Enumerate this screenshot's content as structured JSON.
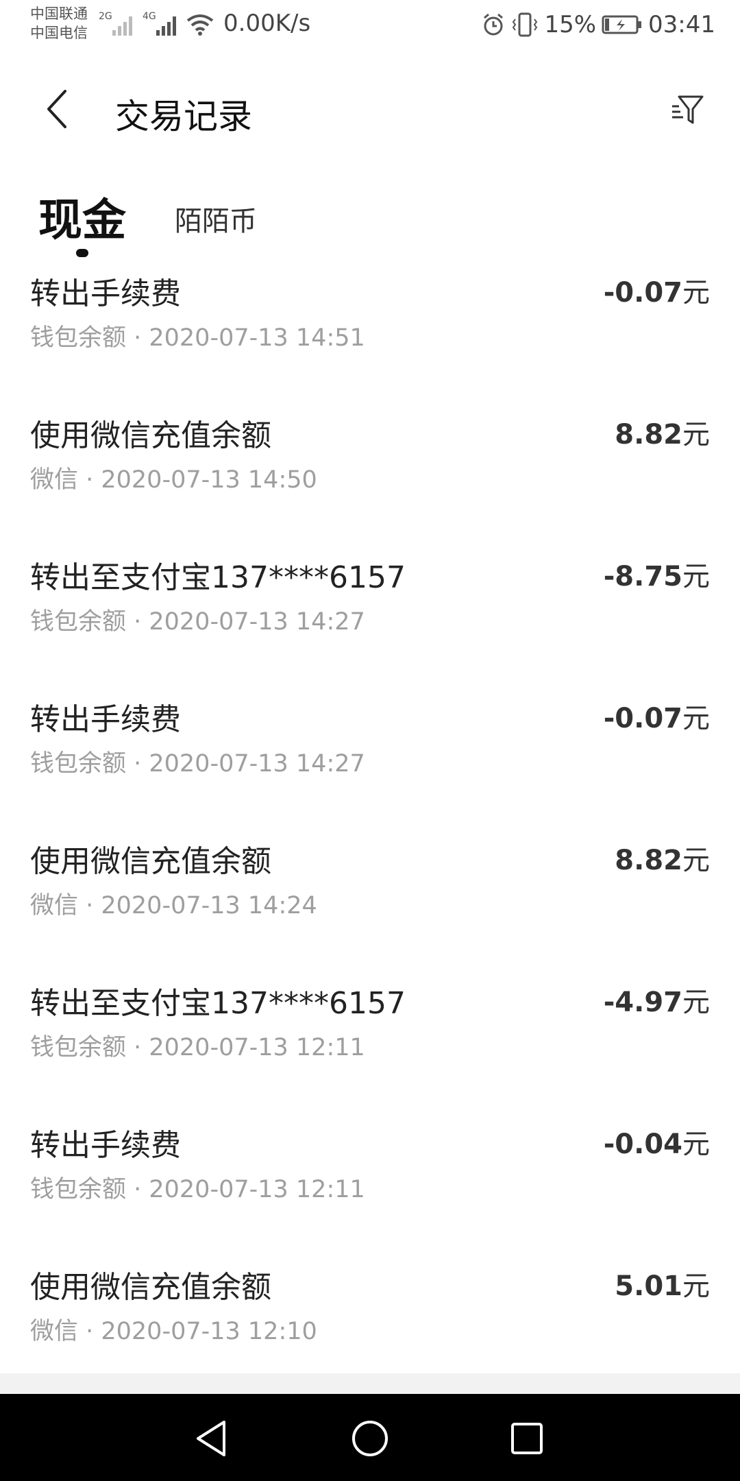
{
  "status_bar": {
    "carrier1": "中国联通",
    "carrier2": "中国电信",
    "net1": "2G",
    "net2": "4G",
    "speed": "0.00K/s",
    "battery": "15%",
    "time": "03:41"
  },
  "header": {
    "title": "交易记录"
  },
  "tabs": {
    "cash": "现金",
    "coin": "陌陌币"
  },
  "transactions": [
    {
      "title": "转出手续费",
      "meta": "钱包余额 · 2020-07-13 14:51",
      "amount": "-0.07",
      "unit": "元"
    },
    {
      "title": "使用微信充值余额",
      "meta": "微信 · 2020-07-13 14:50",
      "amount": "8.82",
      "unit": "元"
    },
    {
      "title": "转出至支付宝137****6157",
      "meta": "钱包余额 · 2020-07-13 14:27",
      "amount": "-8.75",
      "unit": "元"
    },
    {
      "title": "转出手续费",
      "meta": "钱包余额 · 2020-07-13 14:27",
      "amount": "-0.07",
      "unit": "元"
    },
    {
      "title": "使用微信充值余额",
      "meta": "微信 · 2020-07-13 14:24",
      "amount": "8.82",
      "unit": "元"
    },
    {
      "title": "转出至支付宝137****6157",
      "meta": "钱包余额 · 2020-07-13 12:11",
      "amount": "-4.97",
      "unit": "元"
    },
    {
      "title": "转出手续费",
      "meta": "钱包余额 · 2020-07-13 12:11",
      "amount": "-0.04",
      "unit": "元"
    },
    {
      "title": "使用微信充值余额",
      "meta": "微信 · 2020-07-13 12:10",
      "amount": "5.01",
      "unit": "元"
    }
  ],
  "icons": {
    "back": "back-arrow-icon",
    "filter": "filter-icon",
    "nav_back": "nav-back-icon",
    "nav_home": "nav-home-icon",
    "nav_recent": "nav-recent-icon"
  }
}
